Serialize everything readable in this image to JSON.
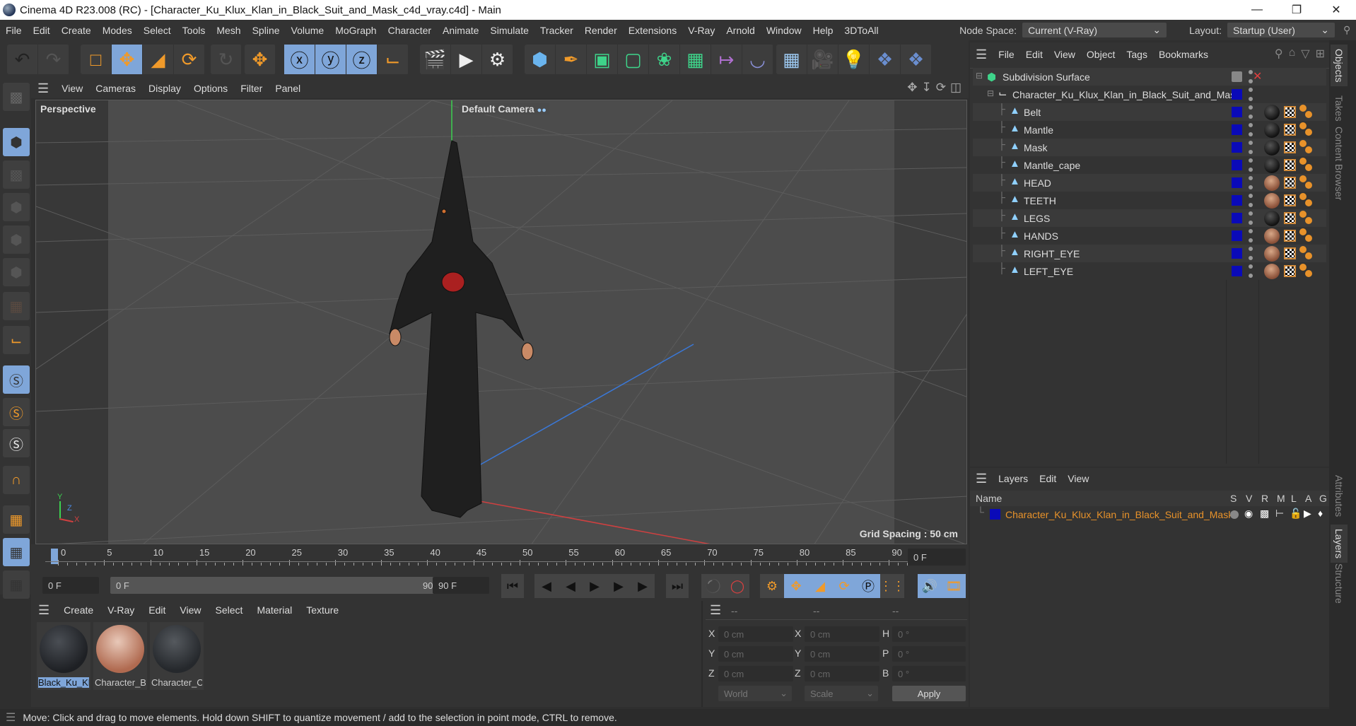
{
  "window": {
    "title": "Cinema 4D R23.008 (RC) - [Character_Ku_Klux_Klan_in_Black_Suit_and_Mask_c4d_vray.c4d] - Main",
    "controls": [
      "minimize",
      "restore",
      "close"
    ]
  },
  "menubar": {
    "items": [
      "File",
      "Edit",
      "Create",
      "Modes",
      "Select",
      "Tools",
      "Mesh",
      "Spline",
      "Volume",
      "MoGraph",
      "Character",
      "Animate",
      "Simulate",
      "Tracker",
      "Render",
      "Extensions",
      "V-Ray",
      "Arnold",
      "Window",
      "Help",
      "3DToAll"
    ],
    "node_space_label": "Node Space:",
    "node_space_value": "Current (V-Ray)",
    "layout_label": "Layout:",
    "layout_value": "Startup (User)"
  },
  "toolbar": {
    "groups": [
      [
        "undo",
        "redo"
      ],
      [
        "live-selection",
        "move",
        "scale",
        "rotate"
      ],
      [
        "psr-lock"
      ],
      [
        "move-dropdown"
      ],
      [
        "x-axis",
        "y-axis",
        "z-axis",
        "coordinate-system"
      ],
      [
        "render-view",
        "render-picture-viewer",
        "render-settings"
      ],
      [
        "cube",
        "pen",
        "subdivision-surface",
        "extrude",
        "symmetry-cloner",
        "mograph-cloner",
        "floor-deformer",
        "bend"
      ],
      [
        "floor",
        "camera",
        "light",
        "python",
        "python-script"
      ]
    ]
  },
  "left_toolbar": {
    "items": [
      "make-editable",
      "model-mode",
      "texture-mode",
      "point-mode",
      "edge-mode",
      "polygon-mode",
      "uvw-mode",
      "axis-mode",
      "snap-off",
      "snap-on",
      "snap-settings",
      "magnet",
      "workplane",
      "workplane-locked",
      "workplane-align"
    ]
  },
  "viewport": {
    "menu": [
      "View",
      "Cameras",
      "Display",
      "Options",
      "Filter",
      "Panel"
    ],
    "view_name": "Perspective",
    "camera": "Default Camera",
    "grid_spacing": "Grid Spacing : 50 cm",
    "axis_labels": {
      "x": "X",
      "y": "Y",
      "z": "Z"
    }
  },
  "timeline": {
    "ticks": [
      "0",
      "5",
      "10",
      "15",
      "20",
      "25",
      "30",
      "35",
      "40",
      "45",
      "50",
      "55",
      "60",
      "65",
      "70",
      "75",
      "80",
      "85",
      "90"
    ],
    "current_frame_field": "0 F",
    "start_field": "0 F",
    "range_start": "0 F",
    "range_end": "90 F",
    "end_field": "90 F"
  },
  "materials": {
    "menu": [
      "Create",
      "V-Ray",
      "Edit",
      "View",
      "Select",
      "Material",
      "Texture"
    ],
    "items": [
      {
        "name": "Black_Ku_Kl",
        "selected": true
      },
      {
        "name": "Character_B",
        "selected": false
      },
      {
        "name": "Character_C",
        "selected": false
      }
    ]
  },
  "coordinates": {
    "headers": [
      "--",
      "--",
      "--"
    ],
    "position": [
      {
        "axis": "X",
        "value": "0 cm"
      },
      {
        "axis": "Y",
        "value": "0 cm"
      },
      {
        "axis": "Z",
        "value": "0 cm"
      }
    ],
    "size": [
      {
        "axis": "X",
        "value": "0 cm"
      },
      {
        "axis": "Y",
        "value": "0 cm"
      },
      {
        "axis": "Z",
        "value": "0 cm"
      }
    ],
    "rotation": [
      {
        "axis": "H",
        "value": "0 °"
      },
      {
        "axis": "P",
        "value": "0 °"
      },
      {
        "axis": "B",
        "value": "0 °"
      }
    ],
    "mode": "World",
    "transform": "Scale",
    "apply_label": "Apply"
  },
  "objects": {
    "menu": [
      "File",
      "Edit",
      "View",
      "Object",
      "Tags",
      "Bookmarks"
    ],
    "root": "Subdivision Surface",
    "group": "Character_Ku_Klux_Klan_in_Black_Suit_and_Mask",
    "children": [
      {
        "name": "Belt",
        "material": "dark"
      },
      {
        "name": "Mantle",
        "material": "dark"
      },
      {
        "name": "Mask",
        "material": "dark"
      },
      {
        "name": "Mantle_cape",
        "material": "dark"
      },
      {
        "name": "HEAD",
        "material": "skin"
      },
      {
        "name": "TEETH",
        "material": "skin"
      },
      {
        "name": "LEGS",
        "material": "dark"
      },
      {
        "name": "HANDS",
        "material": "skin"
      },
      {
        "name": "RIGHT_EYE",
        "material": "skin"
      },
      {
        "name": "LEFT_EYE",
        "material": "skin"
      }
    ],
    "layer_color": "#0a0ab8"
  },
  "layers": {
    "menu": [
      "Layers",
      "Edit",
      "View"
    ],
    "columns": [
      "Name",
      "S",
      "V",
      "R",
      "M",
      "L",
      "A",
      "G"
    ],
    "rows": [
      {
        "name": "Character_Ku_Klux_Klan_in_Black_Suit_and_Mask",
        "color": "#0a0ab8"
      }
    ],
    "name_color": "#e8922a"
  },
  "right_tabs": [
    "Objects",
    "Takes",
    "Content Browser",
    "Attributes",
    "Layers",
    "Structure"
  ],
  "status": {
    "text": "Move: Click and drag to move elements. Hold down SHIFT to quantize movement / add to the selection in point mode, CTRL to remove."
  }
}
